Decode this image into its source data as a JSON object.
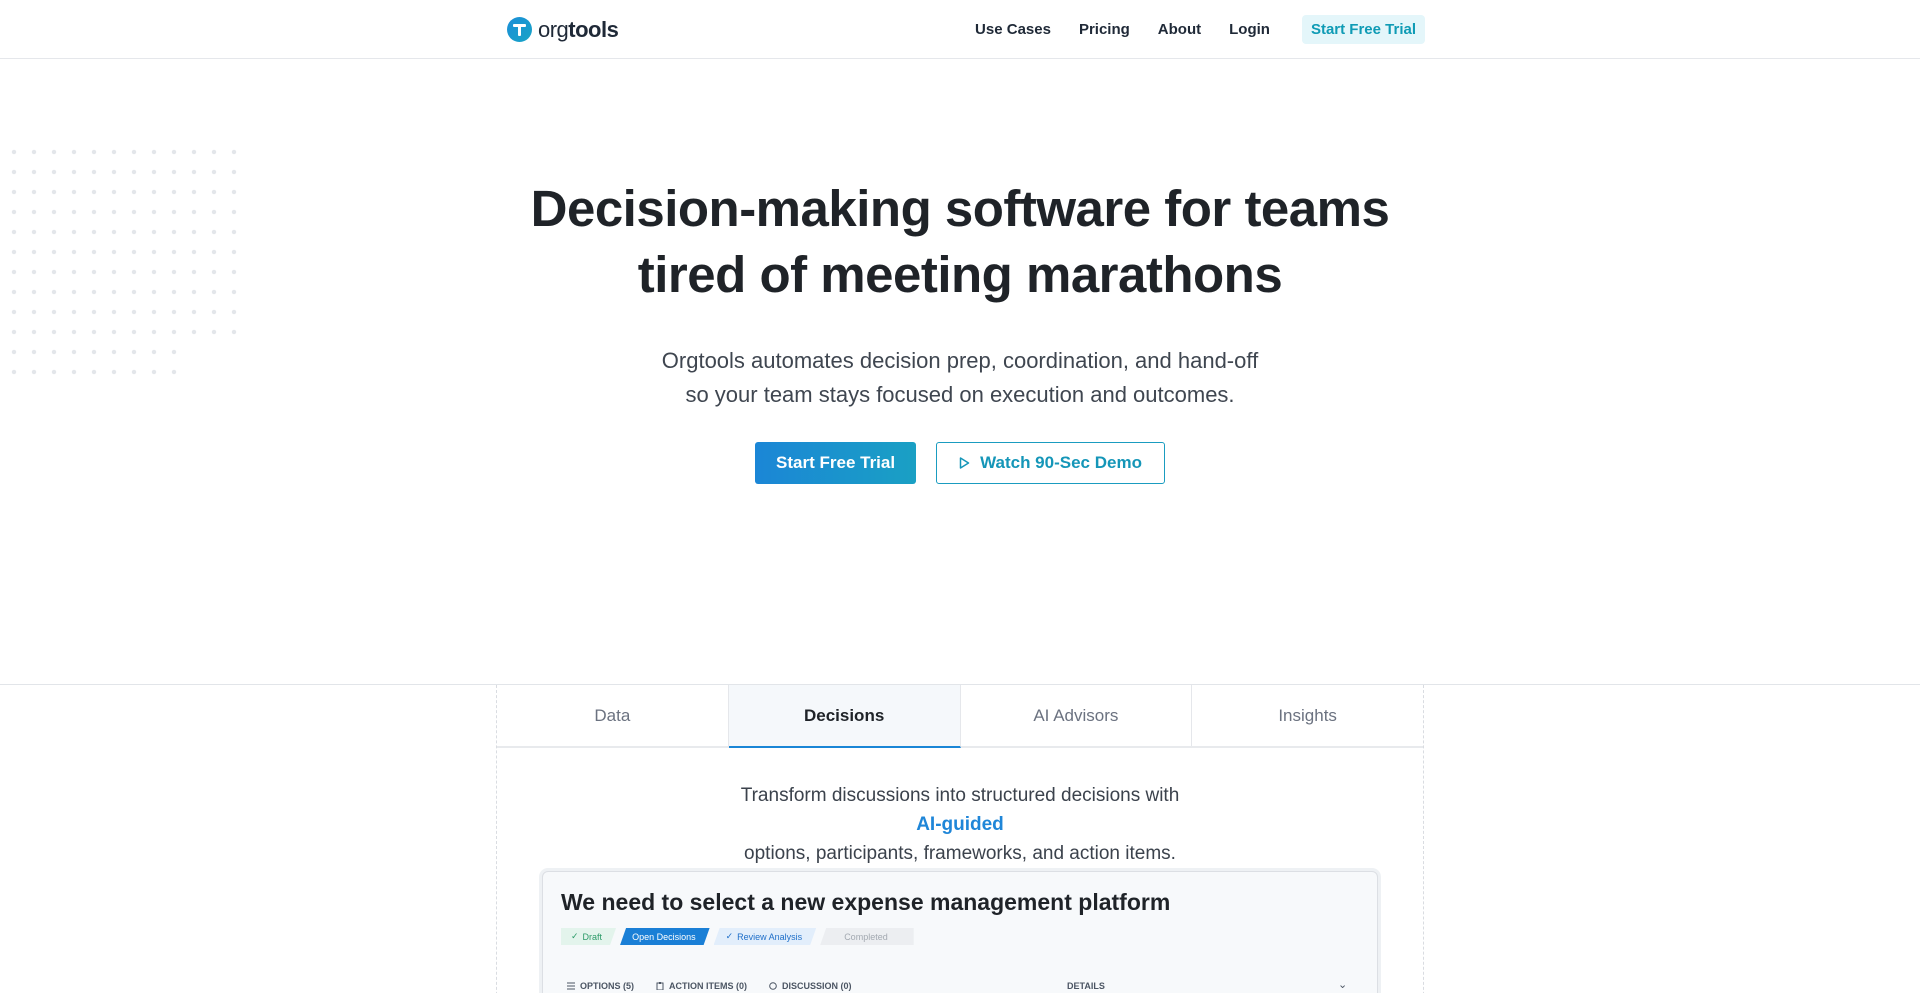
{
  "nav": {
    "logo_light": "org",
    "logo_bold": "tools",
    "links": [
      "Use Cases",
      "Pricing",
      "About",
      "Login"
    ],
    "cta": "Start Free Trial"
  },
  "hero": {
    "title_line1": "Decision-making software for teams",
    "title_line2": "tired of meeting marathons",
    "subtitle_line1": "Orgtools automates decision prep, coordination, and hand-off",
    "subtitle_line2": "so your team stays focused on execution and outcomes.",
    "primary_button": "Start Free Trial",
    "secondary_button": "Watch 90-Sec Demo"
  },
  "tabs": {
    "items": [
      "Data",
      "Decisions",
      "AI Advisors",
      "Insights"
    ],
    "active": "Decisions",
    "desc_before": "Transform discussions into structured decisions with ",
    "desc_highlight": "AI-guided",
    "desc_line2": "options, participants, frameworks, and action items."
  },
  "mockup": {
    "title": "We need to select a new expense management platform",
    "steps": [
      "Draft",
      "Open Decisions",
      "Review Analysis",
      "Completed"
    ],
    "sub_tabs": [
      "OPTIONS (5)",
      "ACTION ITEMS (0)",
      "DISCUSSION (0)"
    ],
    "details_label": "DETAILS"
  },
  "colors": {
    "brand": "#1a86d6",
    "teal": "#17a4c6"
  }
}
